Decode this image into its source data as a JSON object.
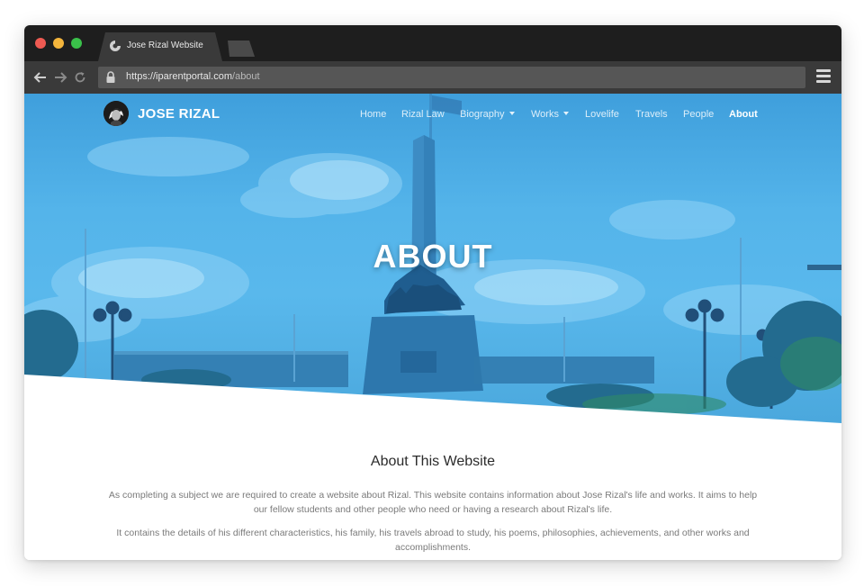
{
  "browser": {
    "tab_title": "Jose Rizal Website",
    "url_host": "https://iparentportal.com",
    "url_path": "/about",
    "icons": {
      "back": "arrow-left-icon",
      "forward": "arrow-right-icon",
      "reload": "reload-icon",
      "lock": "lock-icon",
      "menu": "hamburger-menu-icon",
      "tab_favicon": "site-favicon-icon"
    }
  },
  "site": {
    "brand_name": "JOSE RIZAL",
    "nav": [
      {
        "label": "Home"
      },
      {
        "label": "Rizal Law"
      },
      {
        "label": "Biography"
      },
      {
        "label": "Works"
      },
      {
        "label": "Lovelife"
      },
      {
        "label": "Travels"
      },
      {
        "label": "People"
      },
      {
        "label": "About"
      }
    ],
    "active_nav": "About"
  },
  "hero": {
    "title": "ABOUT",
    "overlay_color": "#4fb0e8"
  },
  "content": {
    "section_title": "About This Website",
    "paragraph_1": "As completing a subject we are required to create a website about Rizal. This website contains information about Jose Rizal's life and works. It aims to help our fellow students and other people who need or having a research about Rizal's life.",
    "paragraph_2": "It contains the details of his different characteristics, his family, his travels abroad to study, his poems, philosophies, achievements, and other works and accomplishments."
  }
}
